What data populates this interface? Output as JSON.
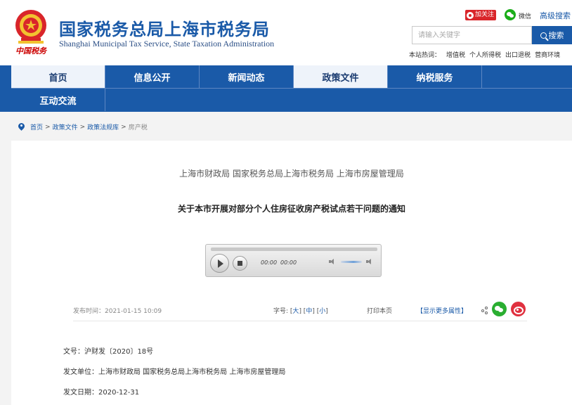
{
  "header": {
    "slogan": "中国税务",
    "title": "国家税务总局上海市税务局",
    "subtitle": "Shanghai Municipal Tax Service, State Taxation Administration",
    "follow_label": "加关注",
    "wechat_label": "微信",
    "advanced_search": "高级搜索",
    "search_placeholder": "请输入关键字",
    "search_button": "搜索",
    "quick_links_label": "本站热词：",
    "quick_links": [
      "增值税",
      "个人所得税",
      "出口退税",
      "营商环境"
    ]
  },
  "nav": {
    "items": [
      "首页",
      "信息公开",
      "新闻动态",
      "政策文件",
      "纳税服务",
      "互动交流"
    ]
  },
  "breadcrumb": {
    "items": [
      "首页",
      "政策文件",
      "政策法规库"
    ],
    "current": "房产税",
    "separator": ">"
  },
  "article": {
    "issuers": "上海市财政局 国家税务总局上海市税务局 上海市房屋管理局",
    "title": "关于本市开展对部分个人住房征收房产税试点若干问题的通知",
    "player": {
      "current_time": "00:00",
      "duration": "00:00"
    },
    "published": "发布时间：2021-01-15 10:09",
    "font_size_label": "字号:",
    "font_sizes": [
      "大",
      "中",
      "小"
    ],
    "print_label": "打印本页",
    "more_attributes": "【显示更多属性】",
    "fields": [
      "文号：沪财发〔2020〕18号",
      "发文单位：上海市财政局 国家税务总局上海市税务局 上海市房屋管理局",
      "发文日期：2020-12-31"
    ]
  },
  "colors": {
    "brand_blue": "#1a5aa8",
    "nav_active_bg": "#eef3fa",
    "follow_red": "#d9252a",
    "wechat_green": "#2aae31",
    "weibo_red": "#e0313f"
  },
  "icons": [
    "national-emblem-icon",
    "eye-icon",
    "wechat-icon",
    "search-icon",
    "location-pin-icon",
    "play-icon",
    "stop-icon",
    "volume-icon",
    "share-icon",
    "weibo-icon"
  ]
}
